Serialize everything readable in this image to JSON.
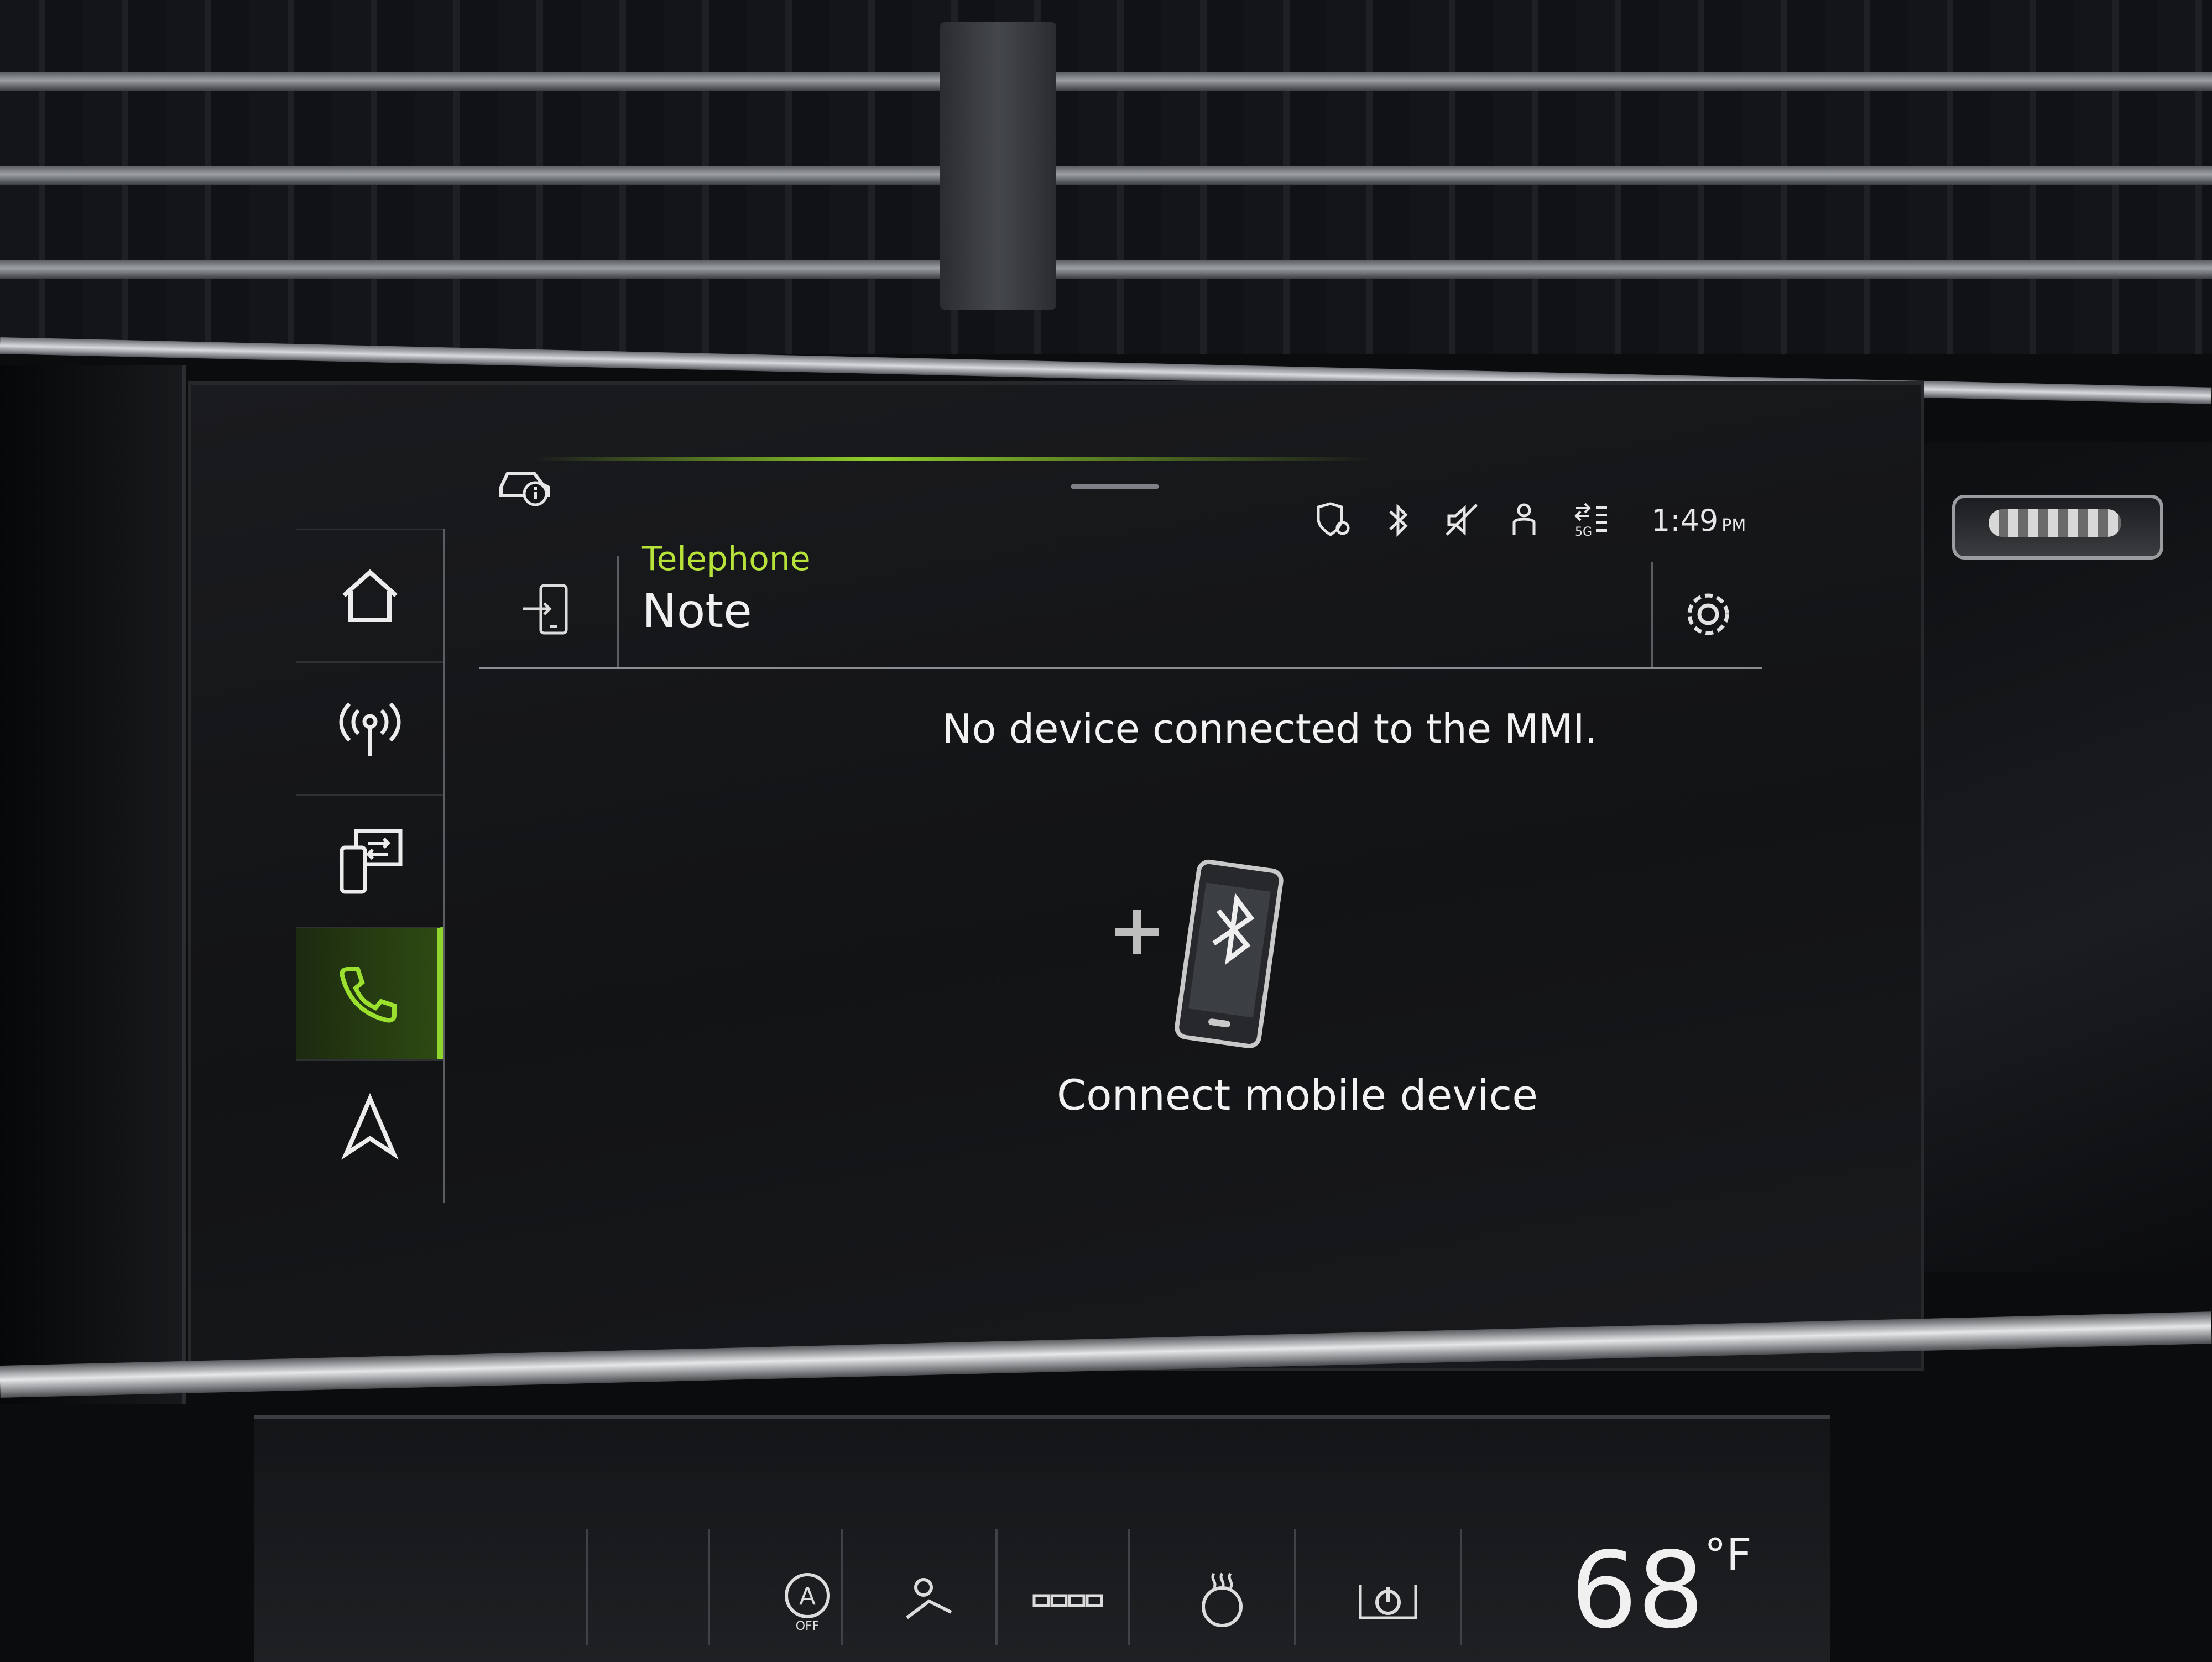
{
  "header": {
    "app_label": "Telephone",
    "title": "Note"
  },
  "status_bar": {
    "time": "1:49",
    "ampm": "PM",
    "icons": [
      "geofence-icon",
      "bluetooth-icon",
      "mute-icon",
      "profile-icon",
      "5g-signal-icon"
    ]
  },
  "sidebar": {
    "items": [
      {
        "icon": "home-icon",
        "active": false
      },
      {
        "icon": "radio-icon",
        "active": false
      },
      {
        "icon": "smartphone-interface-icon",
        "active": false
      },
      {
        "icon": "phone-icon",
        "active": true
      },
      {
        "icon": "navigation-icon",
        "active": false
      }
    ]
  },
  "main": {
    "message": "No device connected to the MMI.",
    "connect_label": "Connect mobile device"
  },
  "climate": {
    "temperature": "68",
    "unit": "°F",
    "auto_label": "A",
    "auto_sub": "OFF"
  },
  "colors": {
    "accent": "#8fd52b",
    "label_green": "#b6e23a",
    "text": "#f0f0f0"
  }
}
